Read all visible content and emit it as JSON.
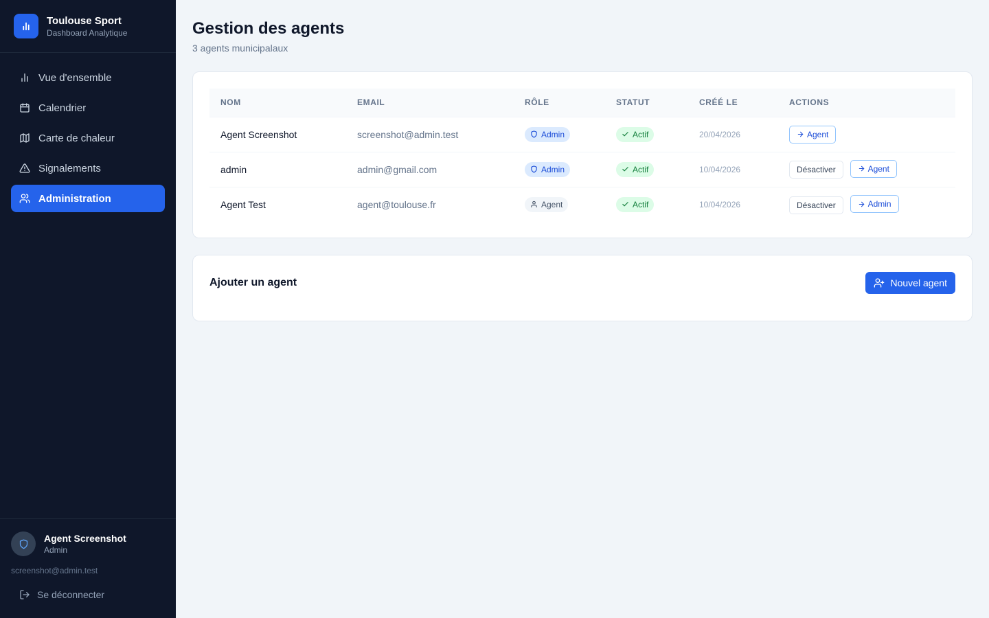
{
  "brand": {
    "title": "Toulouse Sport",
    "subtitle": "Dashboard Analytique"
  },
  "sidebar": {
    "items": [
      {
        "label": "Vue d'ensemble",
        "icon": "bar-chart-icon"
      },
      {
        "label": "Calendrier",
        "icon": "calendar-icon"
      },
      {
        "label": "Carte de chaleur",
        "icon": "map-icon"
      },
      {
        "label": "Signalements",
        "icon": "alert-triangle-icon"
      },
      {
        "label": "Administration",
        "icon": "users-icon",
        "active": true
      }
    ]
  },
  "user": {
    "name": "Agent Screenshot",
    "role": "Admin",
    "email": "screenshot@admin.test",
    "logout_label": "Se déconnecter"
  },
  "page": {
    "title": "Gestion des agents",
    "subtitle": "3 agents municipalaux"
  },
  "table": {
    "headers": [
      "NOM",
      "EMAIL",
      "RÔLE",
      "STATUT",
      "CRÉÉ LE",
      "ACTIONS"
    ],
    "rows": [
      {
        "name": "Agent Screenshot",
        "email": "screenshot@admin.test",
        "role": "Admin",
        "status": "Actif",
        "created": "20/04/2026",
        "actions": [
          "Agent"
        ]
      },
      {
        "name": "admin",
        "email": "admin@gmail.com",
        "role": "Admin",
        "status": "Actif",
        "created": "10/04/2026",
        "actions": [
          "Désactiver",
          "Agent"
        ]
      },
      {
        "name": "Agent Test",
        "email": "agent@toulouse.fr",
        "role": "Agent",
        "status": "Actif",
        "created": "10/04/2026",
        "actions": [
          "Désactiver",
          "Admin"
        ]
      }
    ]
  },
  "add": {
    "title": "Ajouter un agent",
    "button_label": "Nouvel agent"
  },
  "colors": {
    "sidebar_bg": "#0f172a",
    "accent": "#2563eb",
    "page_bg": "#f1f5f9"
  }
}
